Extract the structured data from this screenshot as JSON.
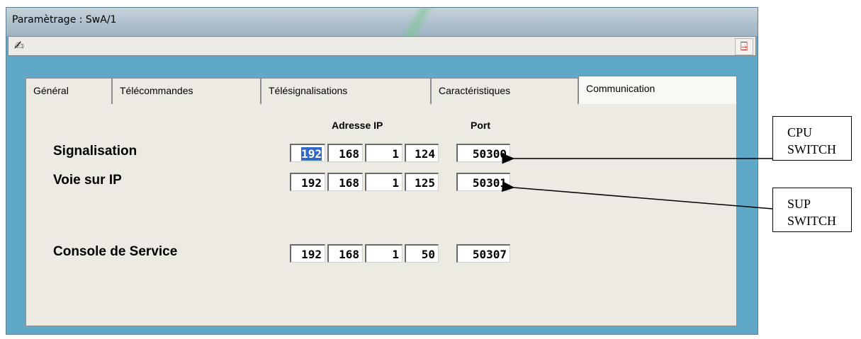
{
  "window": {
    "title": "Paramètrage : SwA/1"
  },
  "toolbar": {
    "edit_icon": "pen-icon",
    "exit_icon": "exit-door-icon"
  },
  "tabs": [
    {
      "label": "Général",
      "active": false
    },
    {
      "label": "Télécommandes",
      "active": false
    },
    {
      "label": "Télésignalisations",
      "active": false
    },
    {
      "label": "Caractéristiques",
      "active": false
    },
    {
      "label": "Communication",
      "active": true
    }
  ],
  "columns": {
    "ip": "Adresse IP",
    "port": "Port"
  },
  "rows": [
    {
      "label": "Signalisation",
      "ip": [
        "192",
        "168",
        "1",
        "124"
      ],
      "port": "50300",
      "selected_octet": 0
    },
    {
      "label": "Voie sur IP",
      "ip": [
        "192",
        "168",
        "1",
        "125"
      ],
      "port": "50301"
    },
    {
      "label": "Console de Service",
      "ip": [
        "192",
        "168",
        "1",
        "50"
      ],
      "port": "50307"
    }
  ],
  "callouts": [
    {
      "line1": "CPU",
      "line2": "SWITCH"
    },
    {
      "line1": "SUP",
      "line2": "SWITCH"
    }
  ],
  "colors": {
    "window_bg": "#5fa8c8",
    "panel_bg": "#eceae2",
    "selection": "#3168c5",
    "exit_icon": "#c01818"
  }
}
